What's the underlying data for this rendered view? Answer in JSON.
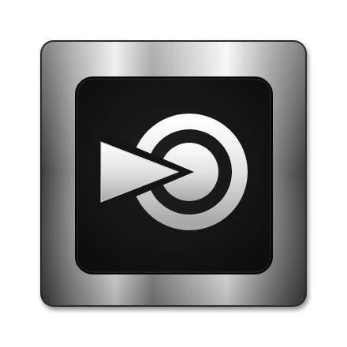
{
  "icon": {
    "name": "blinklist-logo-icon",
    "style": "brushed-metal square app icon with dark inset panel",
    "colors": {
      "frame_light": "#f2f2f2",
      "frame_mid": "#9a9a9a",
      "frame_dark": "#2e2e2e",
      "panel": "#141414",
      "glyph_light": "#f6f6f6",
      "glyph_shade": "#bdbdbd"
    }
  }
}
